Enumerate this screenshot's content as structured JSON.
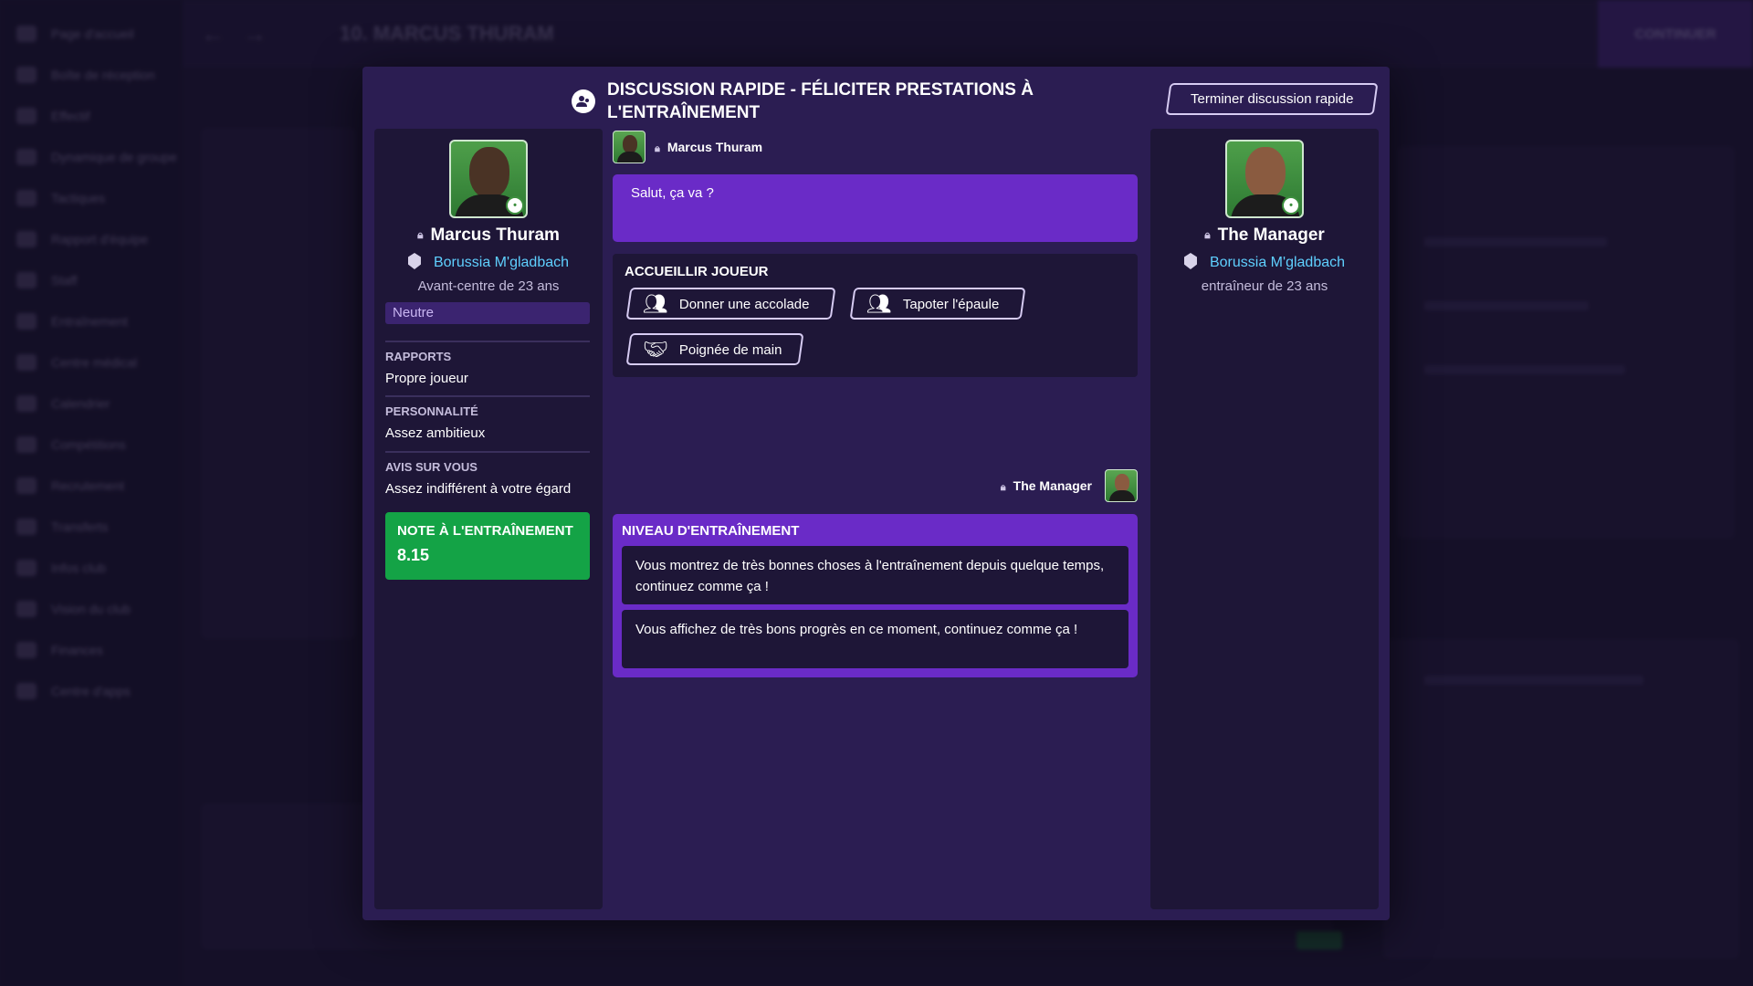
{
  "background": {
    "sidebar_items": [
      "Page d'accueil",
      "Boîte de réception",
      "Effectif",
      "Dynamique de groupe",
      "Tactiques",
      "Rapport d'équipe",
      "Staff",
      "Entraînement",
      "Centre médical",
      "Calendrier",
      "Compétitions",
      "Recrutement",
      "Transferts",
      "Infos club",
      "Vision du club",
      "Finances",
      "Centre d'apps"
    ],
    "top_title": "10. MARCUS THURAM",
    "continue_label": "CONTINUER"
  },
  "modal": {
    "title": "Discussion rapide - Féliciter prestations à l'entraînement",
    "end_button": "Terminer discussion rapide"
  },
  "player": {
    "name": "Marcus Thuram",
    "club": "Borussia M'gladbach",
    "role": "Avant-centre de 23 ans",
    "mood": "Neutre",
    "sections": [
      {
        "label": "RAPPORTS",
        "value": "Propre joueur"
      },
      {
        "label": "PERSONNALITÉ",
        "value": "Assez ambitieux"
      },
      {
        "label": "AVIS SUR VOUS",
        "value": "Assez indifférent à votre égard"
      }
    ],
    "rating_label": "Note à l'entraînement",
    "rating_value": "8.15"
  },
  "manager": {
    "name": "The Manager",
    "club": "Borussia M'gladbach",
    "role": "entraîneur de 23 ans"
  },
  "conversation": {
    "player_name": "Marcus Thuram",
    "player_message": "Salut, ça va ?",
    "options_label": "Accueillir joueur",
    "options": [
      "Donner une accolade",
      "Tapoter l'épaule",
      "Poignée de main"
    ],
    "manager_name": "The Manager",
    "reply_label": "Niveau d'entraînement",
    "replies": [
      "Vous montrez de très bonnes choses à l'entraînement depuis quelque temps, continuez comme ça !",
      "Vous affichez de très bons progrès en ce moment, continuez comme ça !"
    ]
  },
  "colors": {
    "modal_bg": "#2b1d52",
    "card_bg": "#1e1637",
    "accent_purple": "#6a2bc7",
    "rating_green": "#14a346",
    "club_link": "#5fd0ff"
  },
  "icons": {
    "header": "conversation-icon",
    "player_lock": "lock-icon",
    "club": "club-crest-icon",
    "option_1": "hug-icon",
    "option_2": "pat-shoulder-icon",
    "option_3": "handshake-icon"
  }
}
